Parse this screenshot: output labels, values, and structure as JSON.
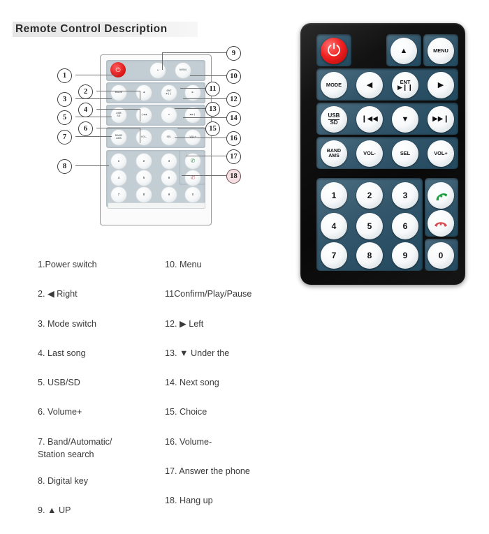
{
  "header": {
    "title": "Remote Control Description"
  },
  "remote": {
    "power_icon": "power-icon",
    "buttons": {
      "mode": "MODE",
      "menu": "MENU",
      "up": "▲",
      "down": "▼",
      "left_arrow": "◀",
      "right_arrow": "▶",
      "ent_top": "ENT",
      "ent_bottom": "▶❙❙",
      "usb_top": "USB",
      "usb_bottom": "SD",
      "prev": "❙◀◀",
      "next": "▶▶❙",
      "band_top": "BAND",
      "band_bottom": "AMS",
      "vol_down": "VOL-",
      "sel": "SEL",
      "vol_up": "VOL+",
      "call_icon": "phone-answer-icon",
      "hangup_icon": "phone-hangup-icon"
    },
    "keypad": [
      "1",
      "2",
      "3",
      "4",
      "5",
      "6",
      "7",
      "8",
      "9",
      "0"
    ]
  },
  "callouts": [
    {
      "n": "1"
    },
    {
      "n": "2"
    },
    {
      "n": "3"
    },
    {
      "n": "4"
    },
    {
      "n": "5"
    },
    {
      "n": "6"
    },
    {
      "n": "7"
    },
    {
      "n": "8"
    },
    {
      "n": "9"
    },
    {
      "n": "10"
    },
    {
      "n": "11"
    },
    {
      "n": "12"
    },
    {
      "n": "13"
    },
    {
      "n": "14"
    },
    {
      "n": "15"
    },
    {
      "n": "16"
    },
    {
      "n": "17"
    },
    {
      "n": "18"
    }
  ],
  "legend": {
    "left_column": [
      "1.Power switch",
      "2. ◀ Right",
      "3. Mode switch",
      "4. Last song",
      "5. USB/SD",
      "6. Volume+",
      "7. Band/Automatic/\n    Station search",
      "8. Digital key",
      "9. ▲ UP"
    ],
    "right_column": [
      "10. Menu",
      "11Confirm/Play/Pause",
      "12. ▶  Left",
      "13. ▼  Under the",
      "14. Next song",
      "15. Choice",
      "16. Volume-",
      "17. Answer the phone",
      "18. Hang up"
    ]
  },
  "colors": {
    "power_red": "#e01b1b",
    "panel_blue": "#33566b",
    "body_black": "#0c0c0c",
    "answer_green": "#1f9e3e",
    "hangup_red": "#d94a52",
    "title_band": "#ececec"
  }
}
